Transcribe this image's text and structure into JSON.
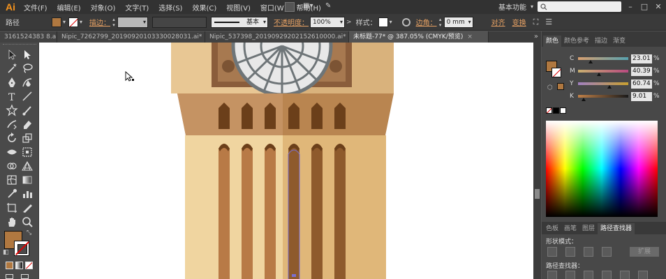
{
  "app": {
    "logo": "Ai"
  },
  "menu": [
    "文件(F)",
    "编辑(E)",
    "对象(O)",
    "文字(T)",
    "选择(S)",
    "效果(C)",
    "视图(V)",
    "窗口(W)",
    "帮助(H)"
  ],
  "workspace": "基本功能",
  "control_bar": {
    "selection_label": "路径",
    "fill_color": "#b07840",
    "stroke_label": "描边：",
    "brush_value": "基本",
    "opacity_label": "不透明度：",
    "opacity_value": "100%",
    "style_label": "样式：",
    "corner_label": "边角：",
    "corner_value": "0 mm",
    "align_label": "对齐",
    "transform_label": "变换"
  },
  "tabs": [
    {
      "label": "3161524383 8.ai*",
      "active": false
    },
    {
      "label": "Nipic_7262799_20190920103330028031.ai*",
      "active": false
    },
    {
      "label": "Nipic_537398_20190929202152610000.ai*",
      "active": false
    },
    {
      "label": "未标题-77* @ 387.05% (CMYK/预览)",
      "active": true
    }
  ],
  "right_panel": {
    "top_tabs": [
      "颜色",
      "颜色参考",
      "描边",
      "渐变"
    ],
    "cmyk": [
      {
        "channel": "C",
        "value": "23.01",
        "pos": 0.23
      },
      {
        "channel": "M",
        "value": "40.39",
        "pos": 0.4
      },
      {
        "channel": "Y",
        "value": "60.74",
        "pos": 0.61
      },
      {
        "channel": "K",
        "value": "9.01",
        "pos": 0.09
      }
    ],
    "percent": "%",
    "bottom_tabs": [
      "色板",
      "画笔",
      "图层",
      "路径查找器"
    ],
    "shape_modes_label": "形状模式：",
    "expand_label": "扩展",
    "pathfinder_label": "路径查找器："
  },
  "colors": {
    "fill": "#b07840",
    "tower_light": "#f0d5a0",
    "tower_mid": "#e0b779",
    "tower_band": "#b98550",
    "tower_dark": "#6b3f1a",
    "column": "#b87a46",
    "column_dark": "#8e5a2c",
    "clock_frame": "#a77950",
    "clock_frame_dark": "#7c5434"
  }
}
